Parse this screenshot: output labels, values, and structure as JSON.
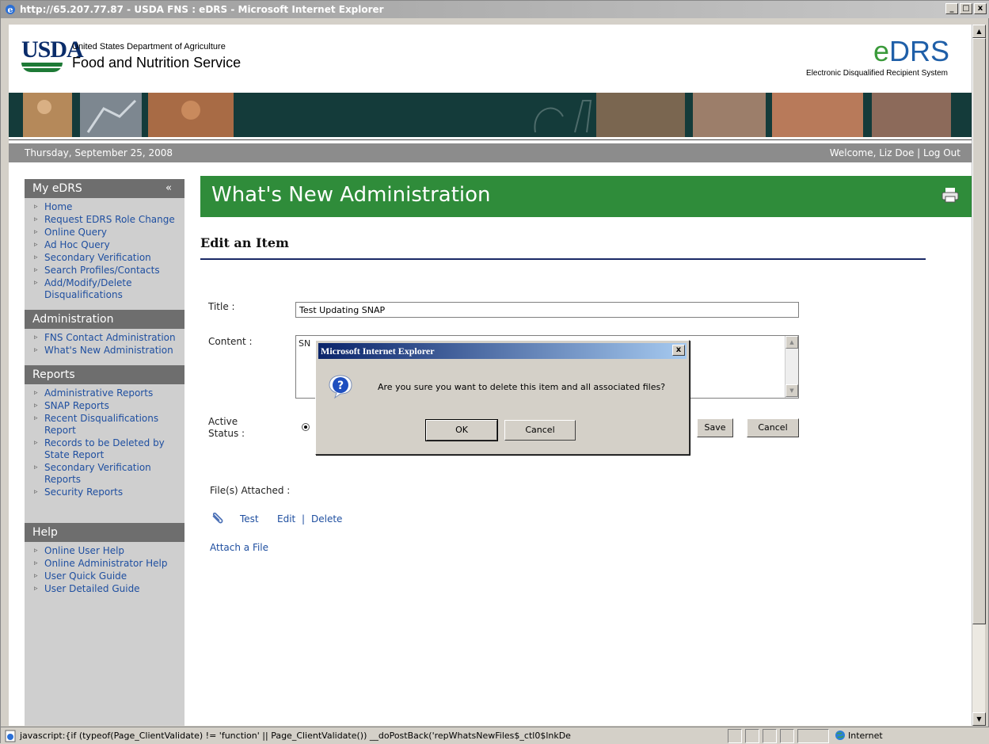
{
  "window": {
    "title": "http://65.207.77.87 - USDA FNS : eDRS - Microsoft Internet Explorer",
    "buttons": [
      "_",
      "□",
      "x"
    ]
  },
  "header": {
    "usda": "USDA",
    "dept": "United States Department of Agriculture",
    "fns": "Food and Nutrition Service",
    "edrs_e": "e",
    "edrs_rest": "DRS",
    "edrs_sub": "Electronic Disqualified Recipient System"
  },
  "datebar": {
    "date": "Thursday, September 25, 2008",
    "welcome": "Welcome, Liz Doe | Log Out"
  },
  "sidebar": {
    "my_edrs": {
      "heading": "My eDRS",
      "collapse": "«",
      "items": [
        "Home",
        "Request EDRS Role Change",
        "Online Query",
        "Ad Hoc Query",
        "Secondary Verification",
        "Search Profiles/Contacts",
        "Add/Modify/Delete Disqualifications"
      ]
    },
    "administration": {
      "heading": "Administration",
      "items": [
        "FNS Contact Administration",
        "What's New Administration"
      ]
    },
    "reports": {
      "heading": "Reports",
      "items": [
        "Administrative Reports",
        "SNAP Reports",
        "Recent Disqualifications Report",
        "Records to be Deleted by State Report",
        "Secondary Verification Reports",
        "Security Reports"
      ]
    },
    "help": {
      "heading": "Help",
      "items": [
        "Online User Help",
        "Online Administrator Help",
        "User Quick Guide",
        "User Detailed Guide"
      ]
    }
  },
  "main": {
    "page_title": "What's New Administration",
    "section_title": "Edit an Item",
    "title_label": "Title :",
    "title_value": "Test Updating SNAP",
    "content_label": "Content :",
    "content_value": "SN",
    "active_label_1": "Active",
    "active_label_2": "Status :",
    "save_label": "Save",
    "cancel_label": "Cancel",
    "files_label": "File(s) Attached :",
    "file_name": "Test",
    "file_edit": "Edit",
    "file_sep": "|",
    "file_delete": "Delete",
    "attach_link": "Attach a File"
  },
  "dialog": {
    "title": "Microsoft Internet Explorer",
    "close": "x",
    "message": "Are you sure you want to delete this item and all associated files?",
    "ok": "OK",
    "cancel": "Cancel"
  },
  "statusbar": {
    "text": "javascript:{if (typeof(Page_ClientValidate) != 'function' ||  Page_ClientValidate()) __doPostBack('repWhatsNewFiles$_ctl0$lnkDe",
    "zone": "Internet"
  },
  "colors": {
    "green": "#2f8c3a",
    "link": "#1f4fa0",
    "sidebar_head": "#6e6e6e",
    "dialog_title": "#0a246a"
  }
}
